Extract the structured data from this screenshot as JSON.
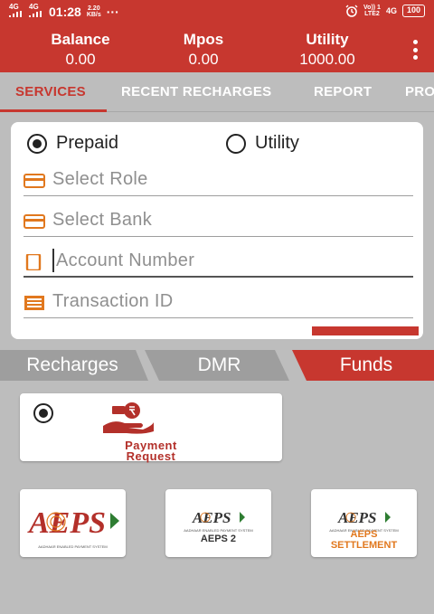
{
  "status_bar": {
    "net1": "4G",
    "net2": "4G",
    "time": "01:28",
    "speed": "2.20",
    "speed_unit": "KB/s",
    "dots": "···",
    "volte": "Vo)) 1",
    "lte": "LTE2",
    "net3": "4G",
    "battery": "100"
  },
  "header": {
    "balance_label": "Balance",
    "balance_value": "0.00",
    "mpos_label": "Mpos",
    "mpos_value": "0.00",
    "utility_label": "Utility",
    "utility_value": "1000.00"
  },
  "tabs": [
    "SERVICES",
    "RECENT RECHARGES",
    "REPORT",
    "PRO"
  ],
  "form": {
    "prepaid_label": "Prepaid",
    "utility_label": "Utility",
    "select_role": "Select Role",
    "select_bank": "Select Bank",
    "account_number": "Account Number",
    "transaction_id": "Transaction ID"
  },
  "segments": [
    "Recharges",
    "DMR",
    "Funds"
  ],
  "tiles": {
    "payment_request_line1": "Payment",
    "payment_request_line2": "Request",
    "aeps_logo": "AEPS",
    "aeps_tagline": "AADHAAR ENABLED PAYMENT SYSTEM",
    "aeps2_label": "AEPS 2",
    "aeps_settlement_line1": "AEPS",
    "aeps_settlement_line2": "SETTLEMENT"
  },
  "colors": {
    "primary_red": "#c7372f",
    "segment_gray": "#9e9e9e",
    "background_gray": "#bdbdbd",
    "settlement_orange": "#e1781e"
  }
}
